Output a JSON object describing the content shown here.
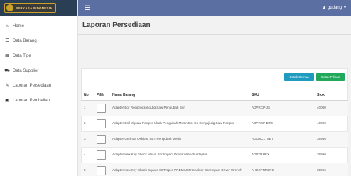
{
  "brand": {
    "logo_text": "PERKASA INDONESIA"
  },
  "topbar": {
    "username": "gudang"
  },
  "sidebar": {
    "items": [
      {
        "label": "Home",
        "icon": "home-icon"
      },
      {
        "label": "Data Barang",
        "icon": "list-icon"
      },
      {
        "label": "Data Tipe",
        "icon": "grid-icon"
      },
      {
        "label": "Data Supplier",
        "icon": "truck-icon"
      },
      {
        "label": "Laporan Persediaan",
        "icon": "edit-icon"
      },
      {
        "label": "Laporan Pembelian",
        "icon": "cart-icon"
      }
    ]
  },
  "main": {
    "title": "Laporan Persediaan",
    "buttons": {
      "print_all": "Cetak Semua",
      "print_selected": "Cetak Pilihan"
    },
    "table": {
      "headers": {
        "no": "No",
        "pilih": "Pilih",
        "nama": "Nama Barang",
        "sku": "SKU",
        "stok": "Stok"
      },
      "rows": [
        {
          "no": "1",
          "nama": "Adapter Bor Reciprocating Jig Saw Pengubah Bor",
          "sku": "ADPRCP-JS",
          "stok": "40000"
        },
        {
          "no": "2",
          "nama": "Adapter Drill Jigsaw Recipro Ubah Pengubah Mesin Bor Ke Gergaji Jig Saw Recipro",
          "sku": "ADPRCP-DZB",
          "stok": "40000"
        },
        {
          "no": "3",
          "nama": "Adapter Gerinda Oskilasi SET Pengubah Mesin",
          "sku": "AGOSCL7SET",
          "stok": "39986"
        },
        {
          "no": "4",
          "nama": "Adapter Hex Key Shock Mesin Bor Impact Driver Wrench Adaptor",
          "sku": "ADPTRHEX",
          "stok": "39990"
        },
        {
          "no": "5",
          "nama": "Adapter Hex Key Shock Square SET 3pcs PREMIUM Konektor Bor Impact Driver Wrench",
          "sku": "AHEXPRM3PC",
          "stok": "39996"
        }
      ]
    }
  }
}
